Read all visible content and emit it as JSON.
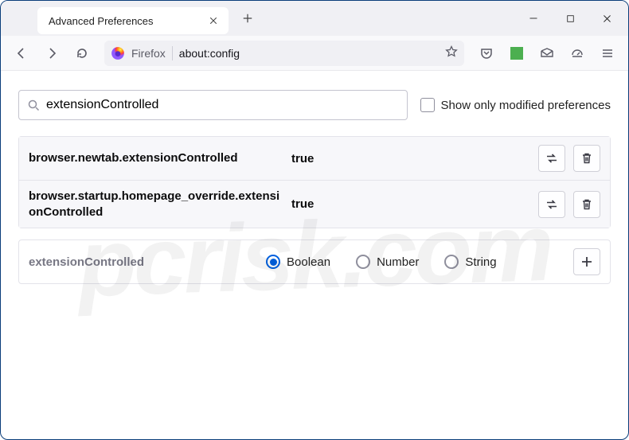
{
  "tab": {
    "title": "Advanced Preferences"
  },
  "urlbar": {
    "identity": "Firefox",
    "url": "about:config"
  },
  "search": {
    "value": "extensionControlled",
    "modified_only_label": "Show only modified preferences"
  },
  "prefs": [
    {
      "name": "browser.newtab.extensionControlled",
      "value": "true"
    },
    {
      "name": "browser.startup.homepage_override.extensionControlled",
      "value": "true"
    }
  ],
  "newpref": {
    "name": "extensionControlled",
    "types": [
      "Boolean",
      "Number",
      "String"
    ],
    "selected": "Boolean"
  },
  "watermark": "pcrisk.com"
}
